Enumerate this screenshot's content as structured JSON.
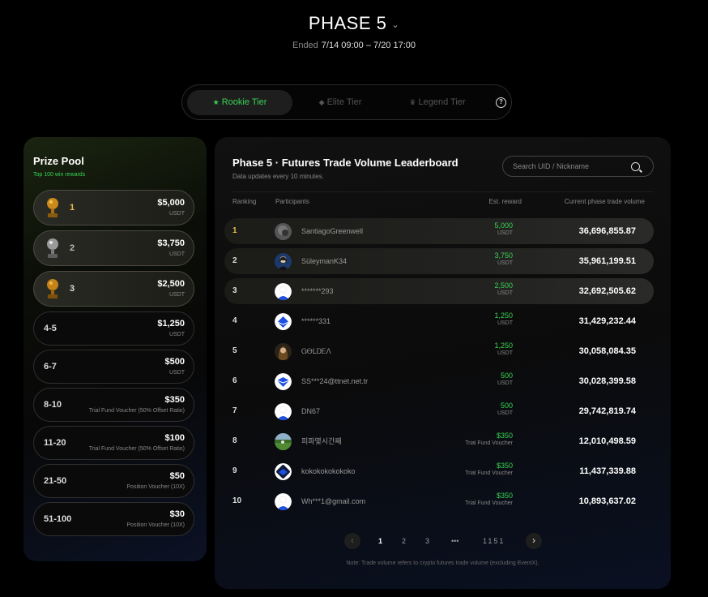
{
  "header": {
    "title": "PHASE 5",
    "ended_label": "Ended",
    "date_range": "7/14 09:00 – 7/20 17:00"
  },
  "tiers": {
    "rookie": "Rookie Tier",
    "elite": "Elite Tier",
    "legend": "Legend Tier",
    "active": "rookie"
  },
  "prize_pool": {
    "title": "Prize Pool",
    "subtitle": "Top 100 win rewards",
    "rows": [
      {
        "rank": "1",
        "amount": "$5,000",
        "unit": "USDT",
        "trophy": "gold-trophy-icon"
      },
      {
        "rank": "2",
        "amount": "$3,750",
        "unit": "USDT",
        "trophy": "silver-trophy-icon"
      },
      {
        "rank": "3",
        "amount": "$2,500",
        "unit": "USDT",
        "trophy": "bronze-trophy-icon"
      },
      {
        "rank": "4-5",
        "amount": "$1,250",
        "unit": "USDT"
      },
      {
        "rank": "6-7",
        "amount": "$500",
        "unit": "USDT"
      },
      {
        "rank": "8-10",
        "amount": "$350",
        "unit": "Trial Fund Voucher (50% Offset Ratio)"
      },
      {
        "rank": "11-20",
        "amount": "$100",
        "unit": "Trial Fund Voucher (50% Offset Ratio)"
      },
      {
        "rank": "21-50",
        "amount": "$50",
        "unit": "Position Voucher (10X)"
      },
      {
        "rank": "51-100",
        "amount": "$30",
        "unit": "Position Voucher (10X)"
      }
    ]
  },
  "leaderboard": {
    "title": "Phase 5 · Futures Trade Volume Leaderboard",
    "subtitle": "Data updates every 10 minutes.",
    "search_placeholder": "Search UID / Nickname",
    "columns": {
      "ranking": "Ranking",
      "participants": "Participants",
      "est_reward": "Est. reward",
      "volume": "Current phase trade volume"
    },
    "rows": [
      {
        "rank": "1",
        "name": "SantiagoGreenwell",
        "reward": "5,000",
        "unit": "USDT",
        "volume": "36,696,855.87",
        "avatar": "photo-avatar"
      },
      {
        "rank": "2",
        "name": "SüleymanK34",
        "reward": "3,750",
        "unit": "USDT",
        "volume": "35,961,199.51",
        "avatar": "photo-avatar"
      },
      {
        "rank": "3",
        "name": "*******293",
        "reward": "2,500",
        "unit": "USDT",
        "volume": "32,692,505.62",
        "avatar": "default-avatar"
      },
      {
        "rank": "4",
        "name": "******331",
        "reward": "1,250",
        "unit": "USDT",
        "volume": "31,429,232.44",
        "avatar": "logo-avatar"
      },
      {
        "rank": "5",
        "name": "ᏀᎾLᎠᎬΛ",
        "reward": "1,250",
        "unit": "USDT",
        "volume": "30,058,084.35",
        "avatar": "photo-avatar"
      },
      {
        "rank": "6",
        "name": "SS***24@ttnet.net.tr",
        "reward": "500",
        "unit": "USDT",
        "volume": "30,028,399.58",
        "avatar": "logo-avatar"
      },
      {
        "rank": "7",
        "name": "DN67",
        "reward": "500",
        "unit": "USDT",
        "volume": "29,742,819.74",
        "avatar": "default-avatar"
      },
      {
        "rank": "8",
        "name": "피파몇시간째",
        "reward": "$350",
        "unit": "Trial Fund Voucher",
        "volume": "12,010,498.59",
        "avatar": "photo-avatar"
      },
      {
        "rank": "9",
        "name": "kokokokokokoko",
        "reward": "$350",
        "unit": "Trial Fund Voucher",
        "volume": "11,437,339.88",
        "avatar": "logo-avatar"
      },
      {
        "rank": "10",
        "name": "Wh***1@gmail.com",
        "reward": "$350",
        "unit": "Trial Fund Voucher",
        "volume": "10,893,637.02",
        "avatar": "default-avatar"
      }
    ],
    "pagination": {
      "pages": [
        "1",
        "2",
        "3"
      ],
      "ellipsis": "•••",
      "last": "1151",
      "current": "1"
    },
    "footnote": "Note: Trade volume refers to crypto futures trade volume (excluding EventX)."
  },
  "colors": {
    "accent_green": "#39d353",
    "background": "#000000"
  }
}
